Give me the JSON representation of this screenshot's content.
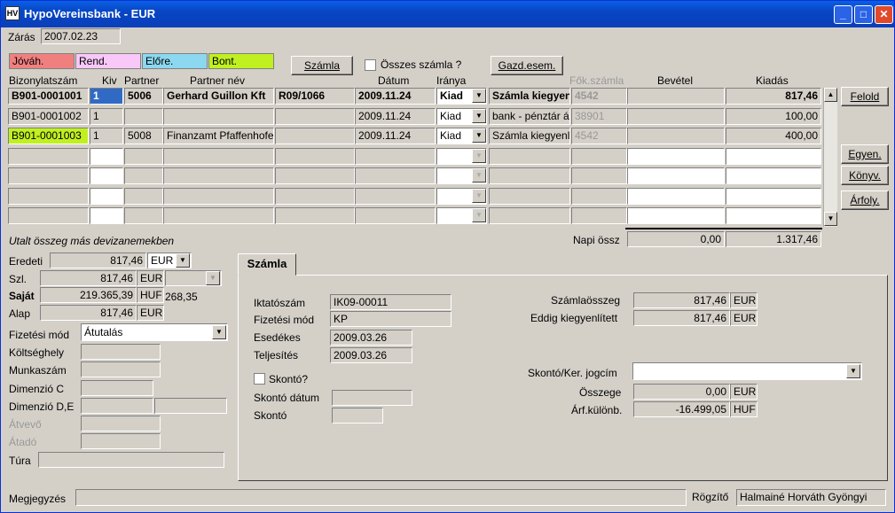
{
  "window": {
    "title": "HypoVereinsbank - EUR",
    "icon": "HV"
  },
  "zaras": {
    "label": "Zárás",
    "value": "2007.02.23"
  },
  "legend": [
    {
      "label": "Jóváh.",
      "color": "#f08080"
    },
    {
      "label": "Rend.",
      "color": "#f8c8f8"
    },
    {
      "label": "Előre.",
      "color": "#8cd8f0"
    },
    {
      "label": "Bont.",
      "color": "#c0f020"
    }
  ],
  "toolbar": {
    "szamla_label": "Számla",
    "osszes_label": "Összes számla ?",
    "gazd_label": "Gazd.esem."
  },
  "table": {
    "headers": {
      "bizonylat": "Bizonylatszám",
      "kiv": "Kiv",
      "partner": "Partner",
      "partner_nev": "Partner név",
      "datum": "Dátum",
      "iranya": "Iránya",
      "fokszamla": "Főkönyvi számla",
      "fok_short": "Fők.számla",
      "bevetel": "Bevétel",
      "kiadas": "Kiadás"
    },
    "rows": [
      {
        "biz": "B901-0001001",
        "kiv": "1",
        "partner": "5006",
        "nev": "Gerhard Guillon Kft",
        "ref": "R09/1066",
        "datum": "2009.11.24",
        "irany": "Kiad",
        "desc": "Számla kiegyenlítés",
        "fok": "4542",
        "bev": "",
        "kiad": "817,46"
      },
      {
        "biz": "B901-0001002",
        "kiv": "1",
        "partner": "",
        "nev": "",
        "ref": "",
        "datum": "2009.11.24",
        "irany": "Kiad",
        "desc": "bank - pénztár átvezetés",
        "fok": "38901",
        "bev": "",
        "kiad": "100,00"
      },
      {
        "biz": "B901-0001003",
        "kiv": "1",
        "partner": "5008",
        "nev": "Finanzamt Pfaffenhofen",
        "ref": "",
        "datum": "2009.11.24",
        "irany": "Kiad",
        "desc": "Számla kiegyenlítés",
        "fok": "4542",
        "bev": "",
        "kiad": "400,00"
      }
    ],
    "napi_label": "Napi össz",
    "napi_bev": "0,00",
    "napi_kiad": "1.317,46"
  },
  "side_buttons": {
    "felold": "Felold",
    "egyen": "Egyen.",
    "konyv": "Könyv.",
    "arfoly": "Árfoly."
  },
  "left": {
    "title": "Utalt összeg más devizanemekben",
    "eredeti": {
      "label": "Eredeti",
      "value": "817,46",
      "cur": "EUR"
    },
    "szl": {
      "label": "Szl.",
      "value": "817,46",
      "cur": "EUR"
    },
    "sajat": {
      "label": "Saját",
      "value": "219.365,39",
      "cur": "HUF",
      "rate": "268,35"
    },
    "alap": {
      "label": "Alap",
      "value": "817,46",
      "cur": "EUR"
    },
    "fizetesi_mod": {
      "label": "Fizetési mód",
      "value": "Átutalás"
    },
    "koltseghely": "Költséghely",
    "munkaszam": "Munkaszám",
    "dimc": "Dimenzió C",
    "dimde": "Dimenzió D,E",
    "atvevo": "Átvevő",
    "atado": "Átadó",
    "tura": "Túra"
  },
  "tab": {
    "label": "Számla"
  },
  "szamla": {
    "iktato": {
      "label": "Iktatószám",
      "value": "IK09-00011"
    },
    "fizmod": {
      "label": "Fizetési mód",
      "value": "KP"
    },
    "esedekes": {
      "label": "Esedékes",
      "value": "2009.03.26"
    },
    "teljesites": {
      "label": "Teljesítés",
      "value": "2009.03.26"
    },
    "skonto_chk": "Skontó?",
    "skonto_datum": "Skontó dátum",
    "skonto": "Skontó",
    "szamlaosszeg": {
      "label": "Számlaösszeg",
      "value": "817,46",
      "cur": "EUR"
    },
    "eddig": {
      "label": "Eddig kiegyenlített",
      "value": "817,46",
      "cur": "EUR"
    },
    "jogcim": {
      "label": "Skontó/Ker. jogcím",
      "value": ""
    },
    "osszege": {
      "label": "Összege",
      "value": "0,00",
      "cur": "EUR"
    },
    "arfkul": {
      "label": "Árf.különb.",
      "value": "-16.499,05",
      "cur": "HUF"
    }
  },
  "footer": {
    "megjegyzes": "Megjegyzés",
    "rogzito_label": "Rögzítő",
    "rogzito_value": "Halmainé Horváth Gyöngyi"
  }
}
